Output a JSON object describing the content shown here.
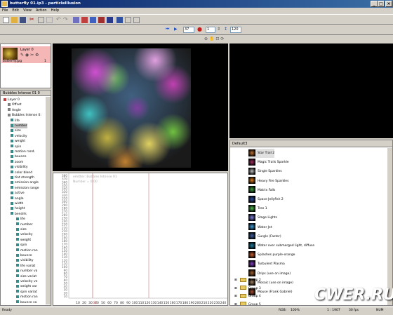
{
  "window": {
    "title": "butterfly 01.ip3 - particleIllusion"
  },
  "menu": [
    "File",
    "Edit",
    "View",
    "Action",
    "Help"
  ],
  "playback": {
    "frame_value": "37",
    "step_value": "1",
    "fps_value": "120"
  },
  "layers": {
    "name": "Layer 0",
    "file": "butterfly.jpg",
    "count": "1"
  },
  "tree": {
    "header": "Bubbles Intense 01 0",
    "items": [
      {
        "label": "Layer 0",
        "indent": 0
      },
      {
        "label": "Offset",
        "indent": 1
      },
      {
        "label": "Angle",
        "indent": 1
      },
      {
        "label": "Bubbles Intense 0:",
        "indent": 1
      },
      {
        "label": "life",
        "indent": 2
      },
      {
        "label": "number",
        "indent": 2
      },
      {
        "label": "size",
        "indent": 2
      },
      {
        "label": "velocity",
        "indent": 2
      },
      {
        "label": "weight",
        "indent": 2
      },
      {
        "label": "spin",
        "indent": 2
      },
      {
        "label": "motion rand.",
        "indent": 2
      },
      {
        "label": "bounce",
        "indent": 2
      },
      {
        "label": "zoom",
        "indent": 2
      },
      {
        "label": "visibility",
        "indent": 2
      },
      {
        "label": "color blend",
        "indent": 2
      },
      {
        "label": "tint strength",
        "indent": 2
      },
      {
        "label": "emission angle",
        "indent": 2
      },
      {
        "label": "emission range",
        "indent": 2
      },
      {
        "label": "active",
        "indent": 2
      },
      {
        "label": "angle",
        "indent": 2
      },
      {
        "label": "width",
        "indent": 2
      },
      {
        "label": "height",
        "indent": 2
      },
      {
        "label": "bendrls",
        "indent": 2
      },
      {
        "label": "life",
        "indent": 3
      },
      {
        "label": "number",
        "indent": 3
      },
      {
        "label": "size",
        "indent": 3
      },
      {
        "label": "velocity",
        "indent": 3
      },
      {
        "label": "weight",
        "indent": 3
      },
      {
        "label": "spin",
        "indent": 3
      },
      {
        "label": "motion ran",
        "indent": 3
      },
      {
        "label": "bounce",
        "indent": 3
      },
      {
        "label": "visibility",
        "indent": 3
      },
      {
        "label": "life variat",
        "indent": 3
      },
      {
        "label": "number va",
        "indent": 3
      },
      {
        "label": "size variat",
        "indent": 3
      },
      {
        "label": "velocity ve",
        "indent": 3
      },
      {
        "label": "weight var",
        "indent": 3
      },
      {
        "label": "spin variat",
        "indent": 3
      },
      {
        "label": "motion ran",
        "indent": 3
      },
      {
        "label": "bounce va",
        "indent": 3
      }
    ]
  },
  "timeline": {
    "graph_label_1": "emitter: Bubbles Intense 01",
    "graph_label_2": "Number = 0.00",
    "y_ticks": [
      "380",
      "370",
      "360",
      "350",
      "340",
      "330",
      "320",
      "310",
      "300",
      "290",
      "280",
      "270",
      "260",
      "250",
      "240",
      "230",
      "220",
      "210",
      "200",
      "190",
      "180",
      "170",
      "160",
      "150",
      "140",
      "130",
      "120",
      "110",
      "100",
      "90",
      "80",
      "70",
      "60",
      "50",
      "40",
      "30",
      "20",
      "10"
    ],
    "x_ticks": [
      "10",
      "20",
      "30",
      "37",
      "40",
      "50",
      "60",
      "70",
      "80",
      "90",
      "100",
      "110",
      "120",
      "130",
      "140",
      "150",
      "160",
      "170",
      "180",
      "190",
      "200",
      "210",
      "220",
      "230",
      "240"
    ]
  },
  "library": {
    "header": "Default3",
    "items": [
      "Star Trail 2",
      "Magic Trails Sparkle",
      "Single Sparkles",
      "Heavy Fire Sparkles",
      "Matrix Falls",
      "Space Jellyfish 2",
      "Tree 1",
      "Stage Lights",
      "Water Jet",
      "Gurgle (Faster)",
      "Water over submerged light, diffuse",
      "Splashes purple-orange",
      "Turbulent Plasma",
      "Drips (use on image)",
      "Mosaic (use on image)",
      "Mouse (Frank Gabriel)"
    ],
    "groups": [
      "Group 2",
      "Group 3",
      "Group 4",
      "Group 5"
    ]
  },
  "status": {
    "ready": "Ready",
    "rgb": "RGB:",
    "percent": "100%",
    "frame": "1 : 1907",
    "fps": "30 fps",
    "num": "NUM"
  },
  "watermark": "CWER.RU"
}
